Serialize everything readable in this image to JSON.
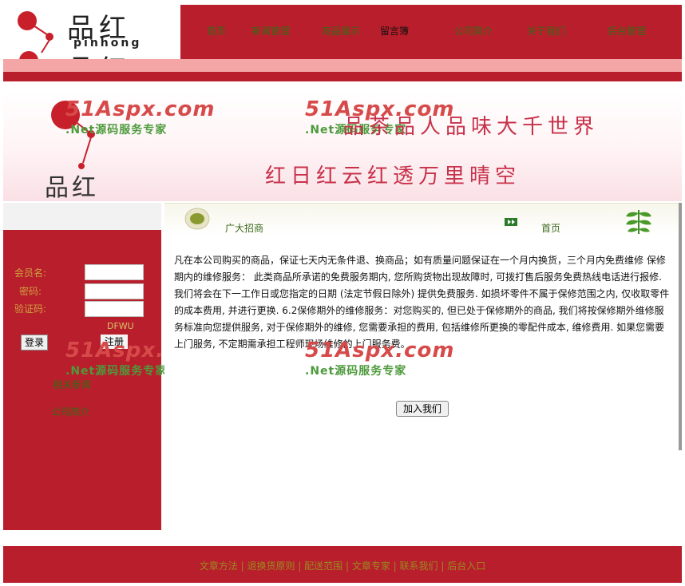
{
  "header": {
    "logo_cn": "品红",
    "logo_en": "pinhong",
    "nav": [
      "首页",
      "新闻管理",
      "商品展示",
      "留言簿",
      "公司简介",
      "关于我们",
      "后台管理"
    ]
  },
  "banner": {
    "watermark_main": "51Aspx.com",
    "watermark_sub": ".Net源码服务专家",
    "slogan1": "品茶品人品味大千世界",
    "slogan2": "红日红云红透万里晴空",
    "logo_cn": "品红"
  },
  "login": {
    "username_label": "会员名:",
    "password_label": "密码:",
    "code_label": "验证码:",
    "code_text": "DFWU",
    "login_button": "登录",
    "register_button": "注册"
  },
  "sidebar": {
    "links": [
      "相关新闻",
      "公司简介"
    ]
  },
  "content": {
    "title": "广大招商",
    "home_link": "首页",
    "body": "凡在本公司购买的商品，保证七天内无条件退、换商品；如有质量问题保证在一个月内换货，三个月内免费维修  保修期内的维修服务：  此类商品所承诺的免费服务期内, 您所购货物出现故障时, 可拨打售后服务免费热线电话进行报修. 我们将会在下一工作日或您指定的日期 (法定节假日除外) 提供免费服务. 如损坏零件不属于保修范围之内, 仅收取零件的成本费用, 并进行更换.  6.2保修期外的维修服务：对您购买的, 但已处于保修期外的商品, 我们将按保修期外维修服务标准向您提供服务, 对于保修期外的维修, 您需要承担的费用, 包括维修所更换的零配件成本, 维修费用. 如果您需要上门服务, 不定期需承担工程师现场维修的上门服务费。",
    "join_button": "加入我们"
  },
  "footer": {
    "links": [
      "文章方法",
      "退换货原则",
      "配送范围",
      "文章专家",
      "联系我们",
      "后台入口"
    ],
    "separator": " | "
  },
  "colors": {
    "brand_red": "#b81e2b",
    "pink": "#f4a6a6",
    "nav_green": "#3a6a1a"
  }
}
